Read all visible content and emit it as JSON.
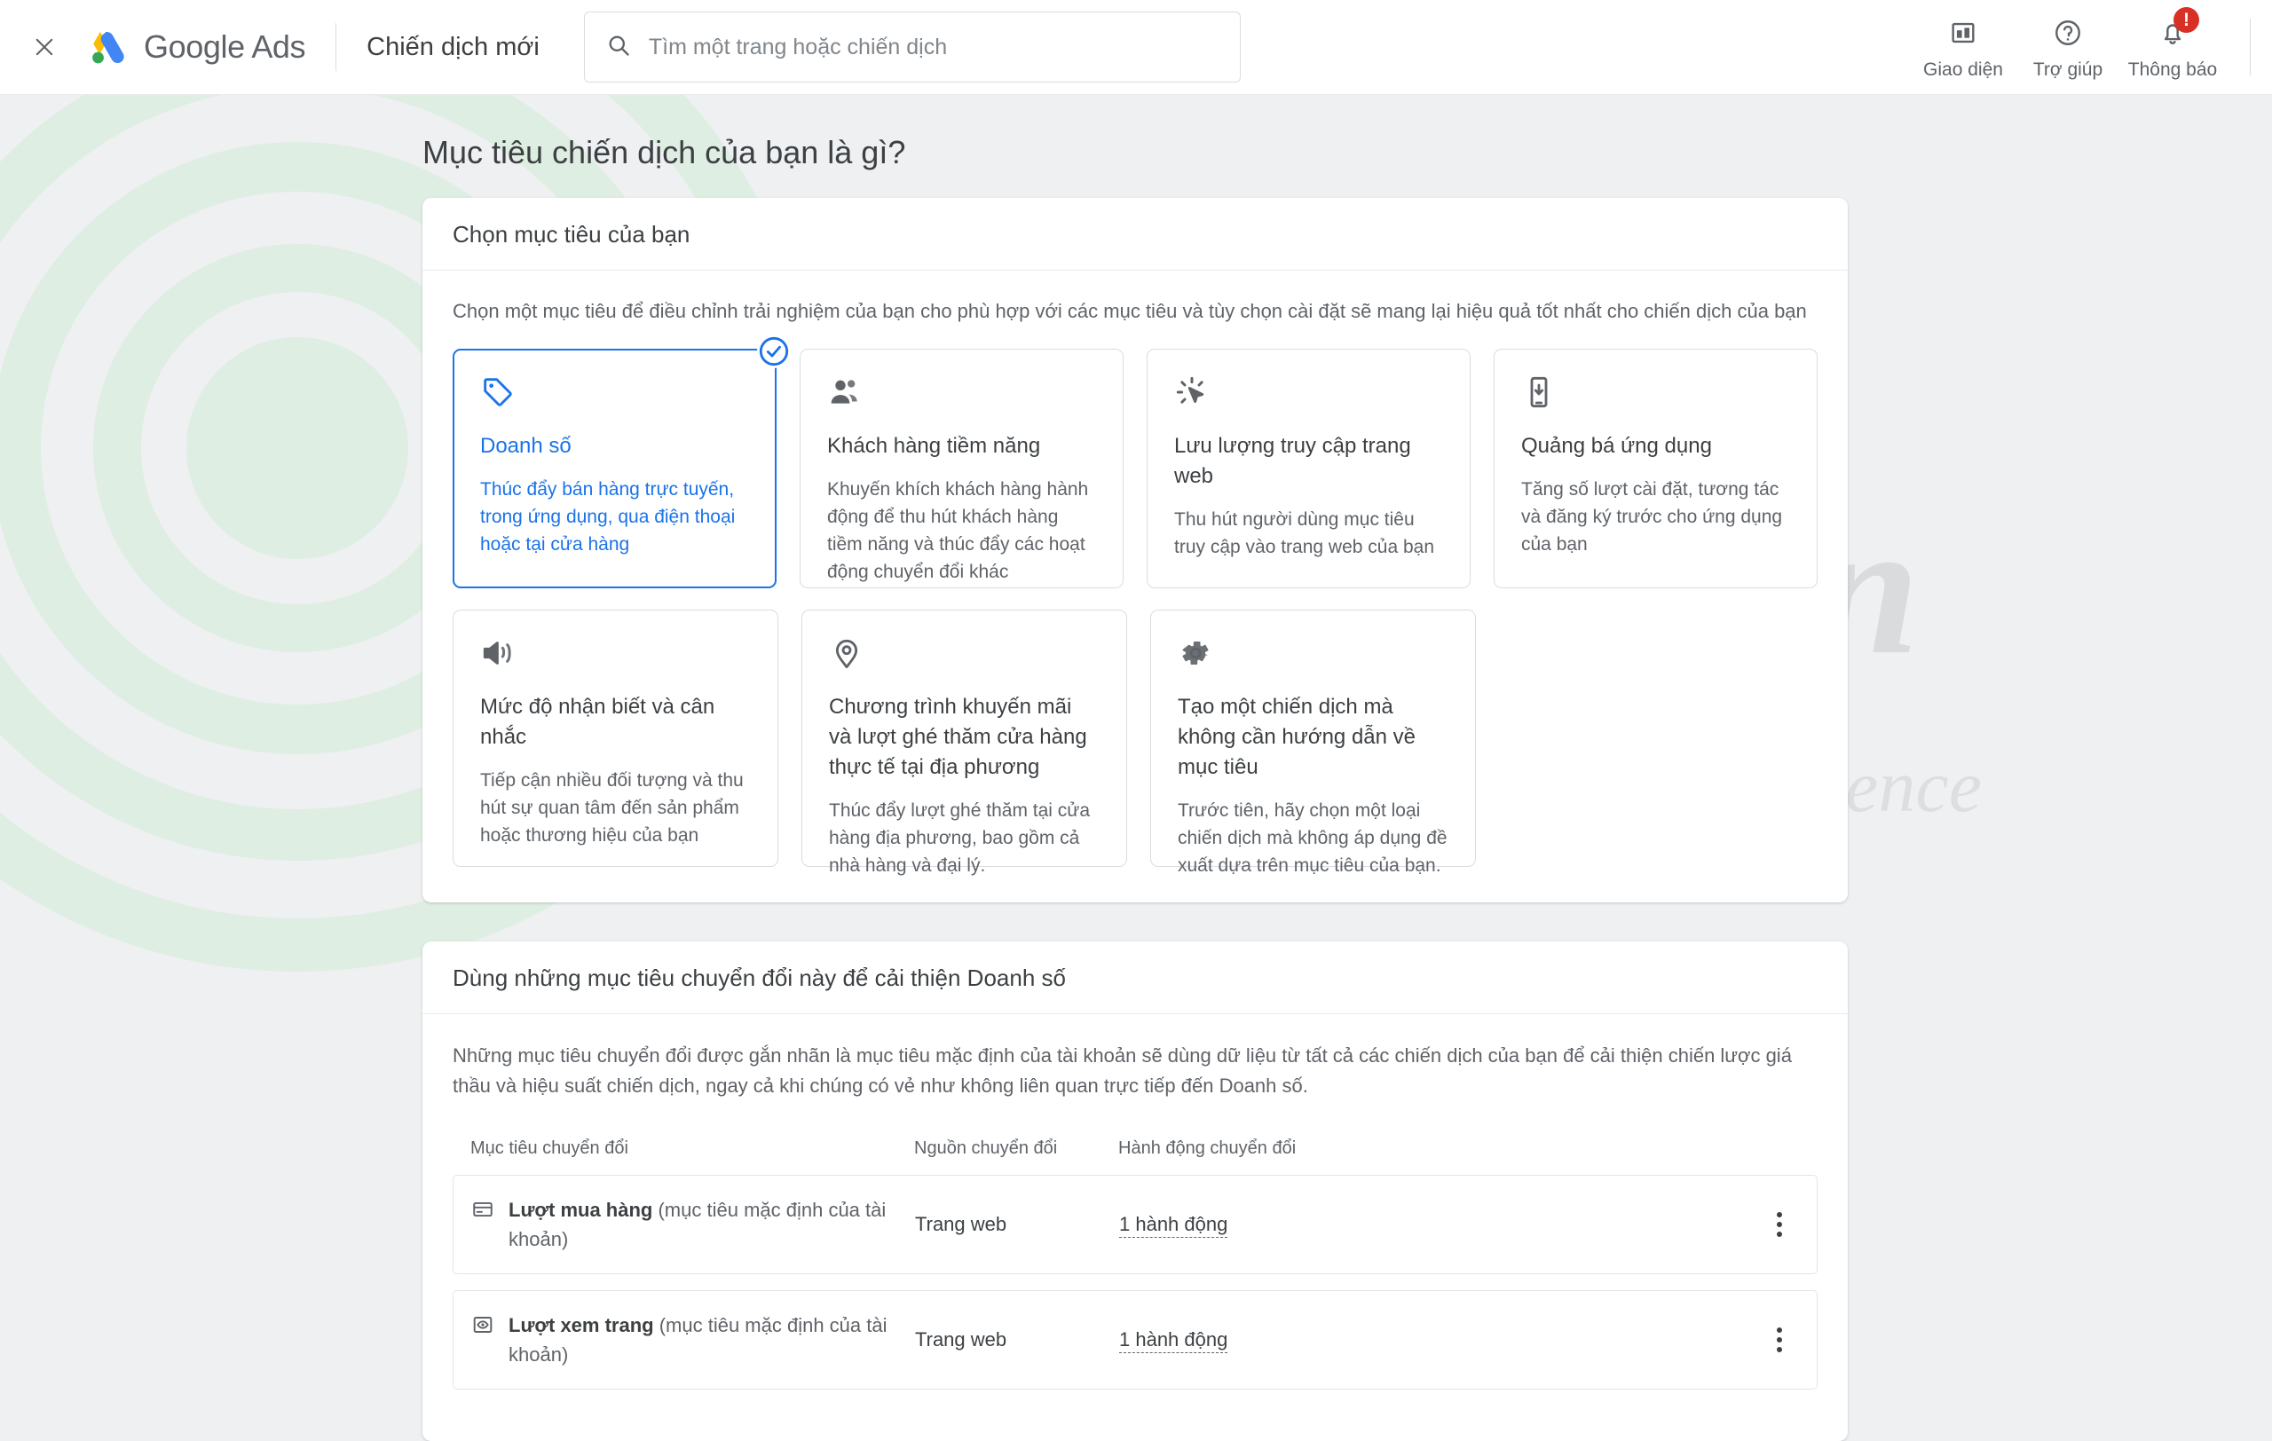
{
  "topbar": {
    "close_label": "✕",
    "brand_google": "Google",
    "brand_ads": "Ads",
    "page_subtitle": "Chiến dịch mới",
    "search_placeholder": "Tìm một trang hoặc chiến dịch",
    "search_value": "",
    "actions": [
      {
        "label": "Giao diện",
        "icon": "appearance-icon"
      },
      {
        "label": "Trợ giúp",
        "icon": "help-icon"
      },
      {
        "label": "Thông báo",
        "icon": "notifications-icon",
        "badge": "!"
      }
    ]
  },
  "page": {
    "title": "Mục tiêu chiến dịch của bạn là gì?"
  },
  "goals_panel": {
    "heading": "Chọn mục tiêu của bạn",
    "description": "Chọn một mục tiêu để điều chỉnh trải nghiệm của bạn cho phù hợp với các mục tiêu và tùy chọn cài đặt sẽ mang lại hiệu quả tốt nhất cho chiến dịch của bạn",
    "cards": [
      {
        "icon": "tag-icon",
        "title": "Doanh số",
        "description": "Thúc đẩy bán hàng trực tuyến, trong ứng dụng, qua điện thoại hoặc tại cửa hàng",
        "selected": true
      },
      {
        "icon": "people-icon",
        "title": "Khách hàng tiềm năng",
        "description": "Khuyến khích khách hàng hành động để thu hút khách hàng tiềm năng và thúc đẩy các hoạt động chuyển đổi khác",
        "selected": false
      },
      {
        "icon": "click-icon",
        "title": "Lưu lượng truy cập trang web",
        "description": "Thu hút người dùng mục tiêu truy cập vào trang web của bạn",
        "selected": false
      },
      {
        "icon": "app-install-icon",
        "title": "Quảng bá ứng dụng",
        "description": "Tăng số lượt cài đặt, tương tác và đăng ký trước cho ứng dụng của bạn",
        "selected": false
      },
      {
        "icon": "megaphone-icon",
        "title": "Mức độ nhận biết và cân nhắc",
        "description": "Tiếp cận nhiều đối tượng và thu hút sự quan tâm đến sản phẩm hoặc thương hiệu của bạn",
        "selected": false
      },
      {
        "icon": "location-pin-icon",
        "title": "Chương trình khuyến mãi và lượt ghé thăm cửa hàng thực tế tại địa phương",
        "description": "Thúc đẩy lượt ghé thăm tại cửa hàng địa phương, bao gồm cả nhà hàng và đại lý.",
        "selected": false
      },
      {
        "icon": "gear-icon",
        "title": "Tạo một chiến dịch mà không cần hướng dẫn về mục tiêu",
        "description": "Trước tiên, hãy chọn một loại chiến dịch mà không áp dụng đề xuất dựa trên mục tiêu của bạn.",
        "selected": false
      }
    ],
    "selected_badge": "check-circle-icon"
  },
  "conversions_panel": {
    "heading": "Dùng những mục tiêu chuyển đổi này để cải thiện Doanh số",
    "description": "Những mục tiêu chuyển đổi được gắn nhãn là mục tiêu mặc định của tài khoản sẽ dùng dữ liệu từ tất cả các chiến dịch của bạn để cải thiện chiến lược giá thầu và hiệu suất chiến dịch, ngay cả khi chúng có vẻ như không liên quan trực tiếp đến Doanh số.",
    "columns": [
      "Mục tiêu chuyển đổi",
      "Nguồn chuyển đổi",
      "Hành động chuyển đổi"
    ],
    "rows": [
      {
        "icon": "credit-card-icon",
        "goal_name": "Lượt mua hàng",
        "goal_note": "(mục tiêu mặc định của tài khoản)",
        "source": "Trang web",
        "action": "1 hành động",
        "menu": "more-options-icon"
      },
      {
        "icon": "page-view-icon",
        "goal_name": "Lượt xem trang",
        "goal_note": "(mục tiêu mặc định của tài khoản)",
        "source": "Trang web",
        "action": "1 hành động",
        "menu": "more-options-icon"
      }
    ]
  },
  "watermark": {
    "main": "IMTA.edu.vn",
    "sub": "Internet Marketing Target Audience"
  },
  "colors": {
    "accent_blue": "#1a73e8",
    "text_primary": "#3c4043",
    "text_secondary": "#5f6368",
    "badge_red": "#d93025",
    "page_bg": "#eef0f2",
    "border": "#dadce0"
  }
}
